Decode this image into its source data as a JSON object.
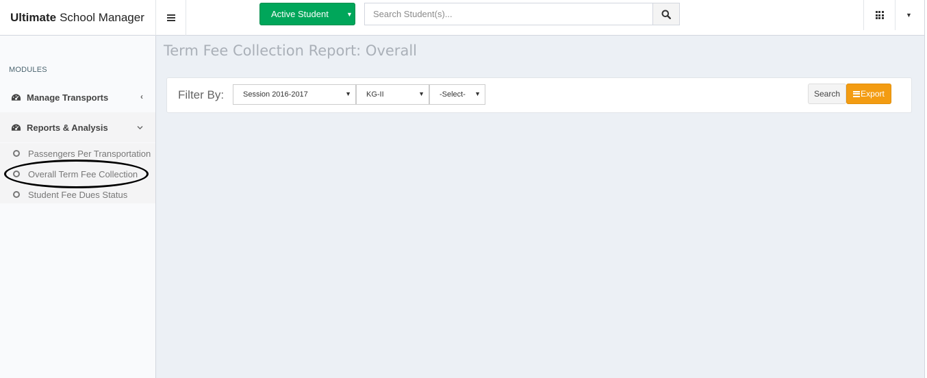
{
  "app": {
    "brand_bold": "Ultimate",
    "brand_rest": "School Manager"
  },
  "header": {
    "student_button": "Active Student",
    "search_placeholder": "Search Student(s)..."
  },
  "sidebar": {
    "header": "MODULES",
    "items": [
      {
        "label": "Manage Transports",
        "icon": "dashboard-icon",
        "chevron": "chevron-left"
      },
      {
        "label": "Reports & Analysis",
        "icon": "dashboard-icon",
        "chevron": "chevron-down"
      }
    ],
    "submenu": [
      {
        "label": "Passengers Per Transportation"
      },
      {
        "label": "Overall Term Fee Collection"
      },
      {
        "label": "Student Fee Dues Status"
      }
    ]
  },
  "main": {
    "title": "Term Fee Collection Report: Overall",
    "filter": {
      "label": "Filter By:",
      "session": "Session 2016-2017",
      "class": "KG-II",
      "section": "-Select-",
      "search_label": "Search",
      "export_label": "Export"
    }
  },
  "colors": {
    "success": "#00a65a",
    "warning": "#f39c12",
    "background": "#ecf0f5",
    "annotation": "#000000"
  }
}
